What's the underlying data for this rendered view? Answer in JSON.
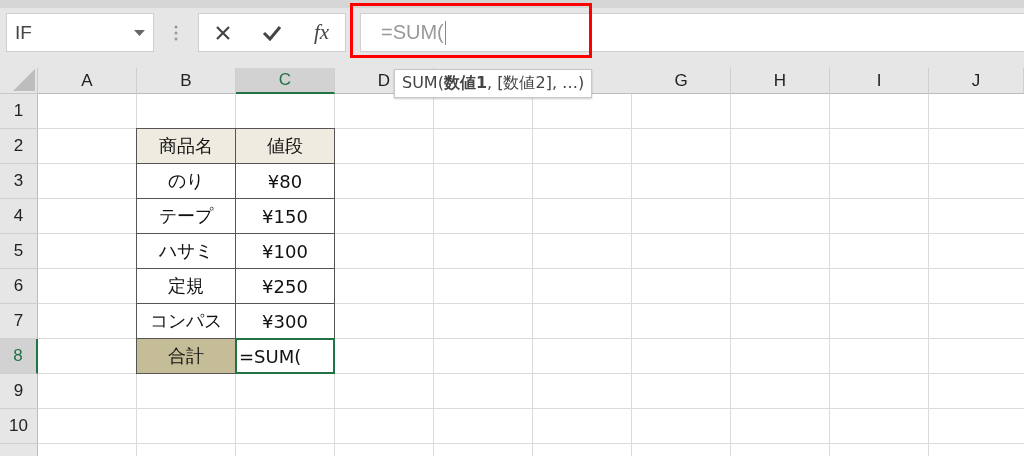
{
  "name_box": {
    "value": "IF"
  },
  "formula_bar": {
    "buttons": [
      {
        "kind": "cancel"
      },
      {
        "kind": "enter"
      },
      {
        "kind": "function",
        "label": "fx"
      }
    ],
    "value": "=SUM(",
    "highlighted": true
  },
  "tooltip": {
    "text": "SUM(**数値1**, [数値2], …)"
  },
  "columns": [
    {
      "label": "A",
      "selected": false
    },
    {
      "label": "B",
      "selected": false
    },
    {
      "label": "C",
      "selected": true
    },
    {
      "label": "D",
      "selected": false
    },
    {
      "label": "G",
      "selected": false
    },
    {
      "label": "H",
      "selected": false
    },
    {
      "label": "I",
      "selected": false
    },
    {
      "label": "J",
      "selected": false
    }
  ],
  "rows": [
    {
      "label": "1",
      "selected": false
    },
    {
      "label": "2",
      "selected": false
    },
    {
      "label": "3",
      "selected": false
    },
    {
      "label": "4",
      "selected": false
    },
    {
      "label": "5",
      "selected": false
    },
    {
      "label": "6",
      "selected": false
    },
    {
      "label": "7",
      "selected": false
    },
    {
      "label": "8",
      "selected": true
    },
    {
      "label": "9",
      "selected": false
    },
    {
      "label": "10",
      "selected": false
    }
  ],
  "table": {
    "header": [
      "商品名",
      "値段"
    ],
    "rows": [
      {
        "name": "のり",
        "price": "¥80"
      },
      {
        "name": "テープ",
        "price": "¥150"
      },
      {
        "name": "ハサミ",
        "price": "¥100"
      },
      {
        "name": "定規",
        "price": "¥250"
      },
      {
        "name": "コンパス",
        "price": "¥300"
      }
    ],
    "total": {
      "label": "合計",
      "value": "=SUM(",
      "editing": true
    }
  }
}
